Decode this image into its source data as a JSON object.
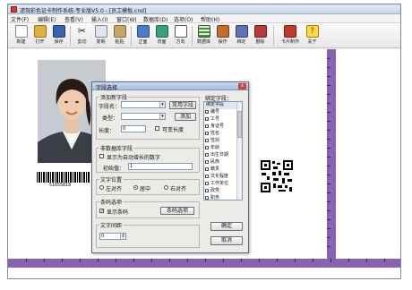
{
  "window": {
    "title": "滤驾彩色证卡制作系统-专业版V5.0 - [员工模板.cnd]"
  },
  "menu": {
    "items": [
      "文件(F)",
      "编辑(E)",
      "查看(V)",
      "输入(I)",
      "窗口(W)",
      "数据库(D)",
      "选项(O)",
      "帮助(H)"
    ]
  },
  "toolbar": {
    "buttons": [
      {
        "label": "新建",
        "icon": "new-file-icon",
        "color": "#ffffff"
      },
      {
        "label": "打开",
        "icon": "open-folder-icon",
        "color": "#e0b040"
      },
      {
        "label": "保存",
        "icon": "save-icon",
        "color": "#3a64b0"
      },
      {
        "label": "剪切",
        "icon": "scissors-icon",
        "color": "#707070"
      },
      {
        "label": "复制",
        "icon": "copy-icon",
        "color": "#9aa6b8"
      },
      {
        "label": "粘贴",
        "icon": "paste-icon",
        "color": "#c9a46a"
      },
      {
        "label": "正面",
        "icon": "front-side-icon",
        "color": "#4a7ac8"
      },
      {
        "label": "背面",
        "icon": "back-side-icon",
        "color": "#3aa07a"
      },
      {
        "label": "方向",
        "icon": "orientation-icon",
        "color": "#7a7a7a"
      },
      {
        "label": "数据库",
        "icon": "database-grid-icon",
        "color": "#4c8a3c"
      },
      {
        "label": "操作",
        "icon": "operation-icon",
        "color": "#c46c2a"
      },
      {
        "label": "绑定",
        "icon": "bind-icon",
        "color": "#5a72b8"
      },
      {
        "label": "删除",
        "icon": "delete-icon",
        "color": "#b83a3a"
      },
      {
        "label": "卡片制作",
        "icon": "card-make-icon",
        "color": "#c0392b"
      },
      {
        "label": "关于",
        "icon": "help-question-icon",
        "color": "#d6a400"
      }
    ]
  },
  "card": {
    "barcode_number": "51655818"
  },
  "dialog": {
    "title": "字段选择",
    "close_label": "x",
    "add_group": {
      "title": "添加新字段",
      "field_name_label": "字段名：",
      "field_name_value": "",
      "common_fields_button": "常用字段",
      "type_label": "类型：",
      "type_value": "",
      "add_button": "添加",
      "length_label": "长度：",
      "length_value": "0",
      "variable_length_label": "可变长度"
    },
    "seq_group": {
      "title": "非数据库字段",
      "auto_increment_label": "显示为自动增长的数字",
      "initial_label": "初始值：",
      "initial_value": "1"
    },
    "position_group": {
      "title": "文字位置",
      "options": [
        "左对齐",
        "居中",
        "右对齐"
      ],
      "selected": 1
    },
    "barcode_group": {
      "title": "条码选项",
      "show_barcode_label": "显示条码",
      "barcode_options_button": "条码选项"
    },
    "spacing_group": {
      "title": "文字间距",
      "value": "0"
    },
    "bound_fields": {
      "title": "绑定字段：",
      "header": "绑定字段",
      "items": [
        {
          "label": "编号",
          "checked": true
        },
        {
          "label": "工号",
          "checked": true
        },
        {
          "label": "身证号",
          "checked": false
        },
        {
          "label": "姓名",
          "checked": true
        },
        {
          "label": "性别",
          "checked": false
        },
        {
          "label": "年龄",
          "checked": false
        },
        {
          "label": "出生日期",
          "checked": false
        },
        {
          "label": "民族",
          "checked": false
        },
        {
          "label": "籍贯",
          "checked": false
        },
        {
          "label": "文化程度",
          "checked": false
        },
        {
          "label": "工作单位",
          "checked": false
        },
        {
          "label": "政党",
          "checked": false
        },
        {
          "label": "职务",
          "checked": false
        }
      ]
    },
    "ok_button": "确定",
    "cancel_button": "取消"
  }
}
